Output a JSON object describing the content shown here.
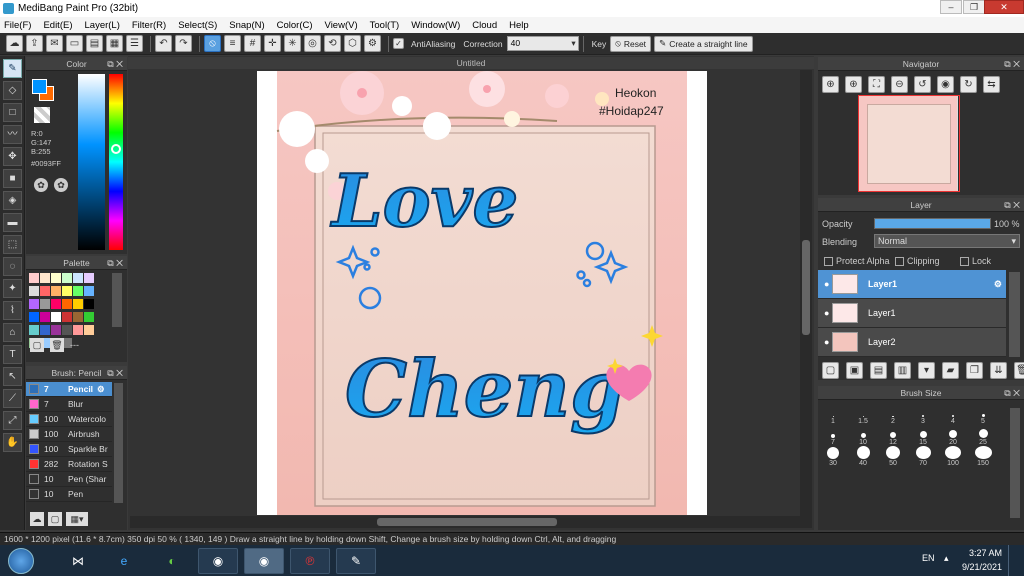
{
  "window": {
    "title": "MediBang Paint Pro (32bit)"
  },
  "menu": [
    "File(F)",
    "Edit(E)",
    "Layer(L)",
    "Filter(R)",
    "Select(S)",
    "Snap(N)",
    "Color(C)",
    "View(V)",
    "Tool(T)",
    "Window(W)",
    "Cloud",
    "Help"
  ],
  "toolbar": {
    "antialiasing": "AntiAliasing",
    "correction_label": "Correction",
    "correction_value": "40",
    "key_label": "Key",
    "reset": "Reset",
    "straight_line": "Create a straight line"
  },
  "color": {
    "title": "Color",
    "r": "R:0",
    "g": "G:147",
    "b": "B:255",
    "hex": "#0093FF",
    "primary": "#0093ff",
    "secondary": "#ff6a00"
  },
  "palette": {
    "title": "Palette",
    "footer": "---"
  },
  "brush": {
    "title": "Brush: Pencil",
    "items": [
      {
        "size": "7",
        "name": "Pencil",
        "color": "#2d6fb8"
      },
      {
        "size": "7",
        "name": "Blur",
        "color": "#ff66cc"
      },
      {
        "size": "100",
        "name": "Watercolo",
        "color": "#66ccff"
      },
      {
        "size": "100",
        "name": "Airbrush",
        "color": "#cccccc"
      },
      {
        "size": "100",
        "name": "Sparkle Br",
        "color": "#3355ff"
      },
      {
        "size": "282",
        "name": "Rotation S",
        "color": "#ff3333"
      },
      {
        "size": "10",
        "name": "Pen (Shar",
        "color": "#333333"
      },
      {
        "size": "10",
        "name": "Pen",
        "color": "#333333"
      }
    ]
  },
  "document": {
    "tab": "Untitled",
    "text_love": "Love",
    "text_cheng": "Cheng",
    "watermark1": "Heokon",
    "watermark2": "#Hoidap247"
  },
  "navigator": {
    "title": "Navigator"
  },
  "layer": {
    "title": "Layer",
    "opacity_label": "Opacity",
    "opacity_value": "100 %",
    "opacity": 1.0,
    "blending_label": "Blending",
    "blending_value": "Normal",
    "protect_alpha": "Protect Alpha",
    "clipping": "Clipping",
    "lock": "Lock",
    "items": [
      "Layer1",
      "Layer1",
      "Layer2"
    ]
  },
  "brushsize": {
    "title": "Brush Size",
    "sizes": [
      "1",
      "1.5",
      "2",
      "3",
      "4",
      "5",
      "7",
      "10",
      "12",
      "15",
      "20",
      "25",
      "30",
      "40",
      "50",
      "70",
      "100",
      "150"
    ]
  },
  "status": {
    "text": "1600 * 1200 pixel  (11.6 * 8.7cm)  350 dpi  50 %  ( 1340, 149 )  Draw a straight line by holding down Shift, Change a brush size by holding down Ctrl, Alt, and dragging"
  },
  "taskbar": {
    "lang": "EN",
    "time": "3:27 AM",
    "date": "9/21/2021"
  }
}
